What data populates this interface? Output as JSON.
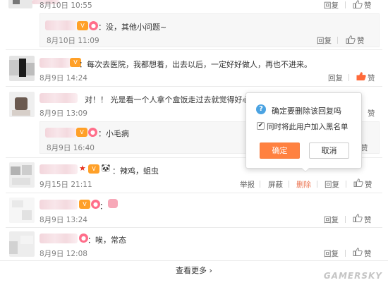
{
  "labels": {
    "reply": "回复",
    "like": "赞",
    "report": "举报",
    "block": "屏蔽",
    "delete": "删除"
  },
  "comments": [
    {
      "date": "8月10日 10:55"
    },
    {
      "text": "：没，其他小问题~",
      "date": "8月10日 11:09"
    },
    {
      "text": "：每次去医院，我都想着，出去以后，一定好好做人，再也不进来。",
      "date": "8月9日 14:24"
    },
    {
      "text": "对！！ 光是看一个人拿个盒饭走过去就觉得好心",
      "date": "8月9日 13:09"
    },
    {
      "text": "：小毛病",
      "date": "8月9日 16:40"
    },
    {
      "text": "：辣鸡，蛆虫",
      "date": "9月15日 21:11"
    },
    {
      "text": "：",
      "date": "8月9日 13:24"
    },
    {
      "text": "：唉，常态",
      "date": "8月9日 12:08"
    }
  ],
  "more_link": "查看更多 ›",
  "dialog": {
    "title": "确定要删除该回复吗",
    "checkbox_label": "同时将此用户加入黑名单",
    "checkbox_checked": true,
    "ok": "确定",
    "cancel": "取消"
  },
  "watermark": "GAMERSKY",
  "colors": {
    "accent": "#ff8140",
    "delete_link": "#eb7350",
    "info_icon": "#4ba3e2",
    "liked_thumb": "#ff6a3a"
  },
  "icons": {
    "like": "thumb-up-icon",
    "question": "question-icon",
    "checkbox": "checkbox-icon"
  }
}
